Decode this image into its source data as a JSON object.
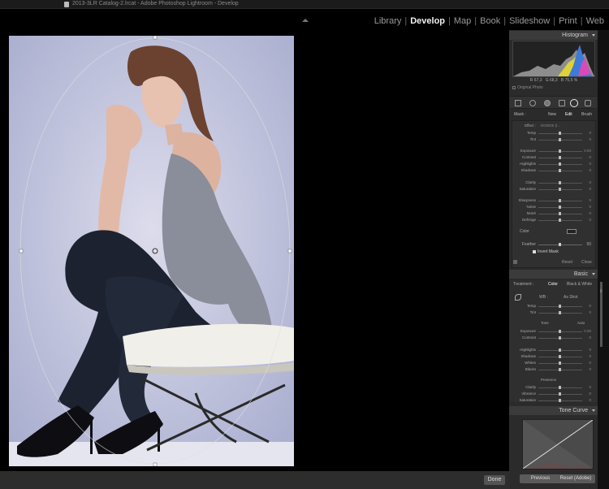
{
  "window": {
    "title": "2013-3LR Catalog-2.lrcat - Adobe Photoshop Lightroom - Develop"
  },
  "modules": {
    "items": [
      {
        "label": "Library"
      },
      {
        "label": "Develop"
      },
      {
        "label": "Map"
      },
      {
        "label": "Book"
      },
      {
        "label": "Slideshow"
      },
      {
        "label": "Print"
      },
      {
        "label": "Web"
      }
    ],
    "active": "Develop"
  },
  "toolbar": {
    "done_label": "Done"
  },
  "histogram": {
    "header": "Histogram",
    "r_label": "R",
    "r_value": "67,3",
    "g_label": "G",
    "g_value": "68,3",
    "b_label": "B",
    "b_value": "75,5 %",
    "original_photo_label": "Original Photo"
  },
  "mask": {
    "label": "Mask :",
    "new": "New",
    "edit": "Edit",
    "brush": "Brush",
    "effect_label": "Effect :",
    "effect_value": "DODGE (l...",
    "rows": [
      {
        "label": "Temp",
        "value": "0"
      },
      {
        "label": "Tint",
        "value": "0"
      },
      {
        "label": "Exposure",
        "value": "0.00"
      },
      {
        "label": "Contrast",
        "value": "0"
      },
      {
        "label": "Highlights",
        "value": "0"
      },
      {
        "label": "Shadows",
        "value": "0"
      },
      {
        "label": "Clarity",
        "value": "0"
      },
      {
        "label": "Saturation",
        "value": "0"
      },
      {
        "label": "Sharpness",
        "value": "0"
      },
      {
        "label": "Noise",
        "value": "0"
      },
      {
        "label": "Moiré",
        "value": "0"
      },
      {
        "label": "Defringe",
        "value": "0"
      }
    ],
    "color_label": "Color",
    "feather_label": "Feather",
    "feather_value": "50",
    "invert_label": "Invert Mask",
    "reset_label": "Reset",
    "close_label": "Close"
  },
  "basic": {
    "header": "Basic",
    "treatment_label": "Treatment :",
    "color_label": "Color",
    "bw_label": "Black & White",
    "wb_label": "WB :",
    "wb_value": "As Shot",
    "tone_label": "Tone",
    "auto_label": "Auto",
    "presence_label": "Presence",
    "rows": [
      {
        "label": "Temp",
        "value": "0"
      },
      {
        "label": "Tint",
        "value": "0"
      },
      {
        "label": "Exposure",
        "value": "0.00"
      },
      {
        "label": "Contrast",
        "value": "0"
      },
      {
        "label": "Highlights",
        "value": "0"
      },
      {
        "label": "Shadows",
        "value": "0"
      },
      {
        "label": "Whites",
        "value": "0"
      },
      {
        "label": "Blacks",
        "value": "0"
      },
      {
        "label": "Clarity",
        "value": "0"
      },
      {
        "label": "Vibrance",
        "value": "0"
      },
      {
        "label": "Saturation",
        "value": "0"
      }
    ]
  },
  "tone_curve": {
    "header": "Tone Curve"
  },
  "buttons": {
    "previous": "Previous",
    "reset": "Reset (Adobe)"
  }
}
